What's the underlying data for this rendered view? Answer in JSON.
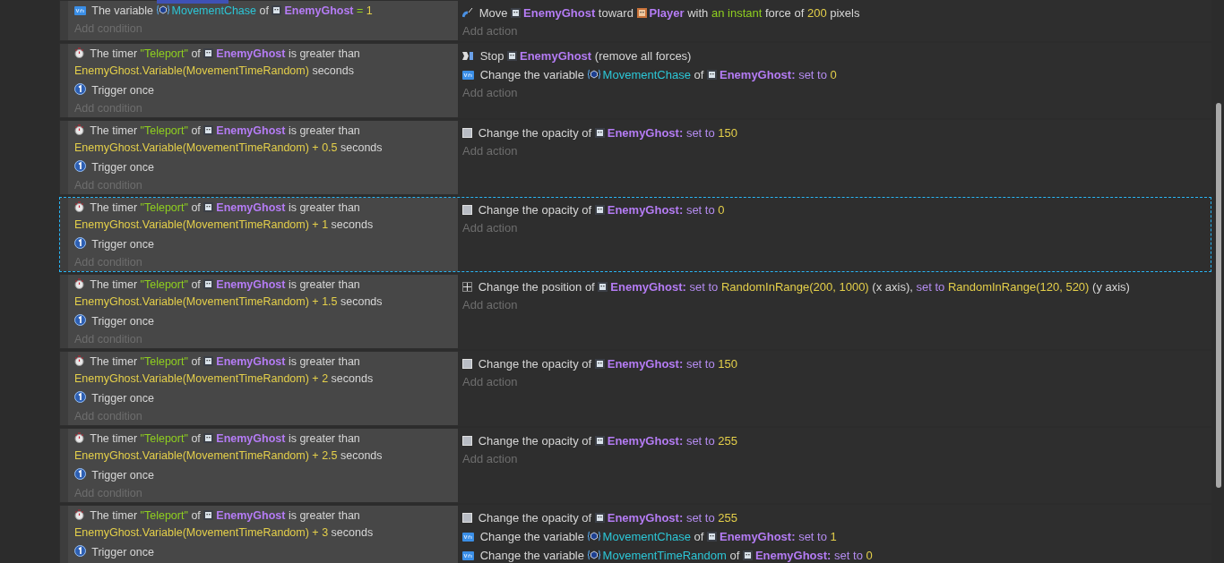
{
  "events": [
    {
      "selected": false,
      "conditions": [
        {
          "kind": "variable",
          "parts": [
            {
              "kind": "text",
              "text": "The variable"
            },
            {
              "kind": "variable",
              "text": "MovementChase"
            },
            {
              "kind": "text",
              "text": "of"
            },
            {
              "kind": "object",
              "text": "EnemyGhost"
            },
            {
              "kind": "choice",
              "text": "="
            },
            {
              "kind": "expr",
              "text": "1"
            }
          ]
        }
      ],
      "add_condition": "Add condition",
      "actions": [
        {
          "kind": "force",
          "parts": [
            {
              "kind": "text",
              "text": "Move"
            },
            {
              "kind": "object",
              "text": "EnemyGhost"
            },
            {
              "kind": "text",
              "text": "toward"
            },
            {
              "kind": "player",
              "text": "Player"
            },
            {
              "kind": "text",
              "text": "with"
            },
            {
              "kind": "choice",
              "text": "an instant"
            },
            {
              "kind": "text",
              "text": "force of"
            },
            {
              "kind": "expr",
              "text": "200"
            },
            {
              "kind": "text",
              "text": "pixels"
            }
          ]
        }
      ],
      "add_action": "Add action"
    },
    {
      "selected": false,
      "conditions": [
        {
          "kind": "timer",
          "parts": [
            {
              "kind": "text",
              "text": "The timer"
            },
            {
              "kind": "string",
              "text": "\"Teleport\""
            },
            {
              "kind": "text",
              "text": "of"
            },
            {
              "kind": "object",
              "text": "EnemyGhost"
            },
            {
              "kind": "text",
              "text": "is greater than"
            },
            {
              "kind": "expr",
              "text": "EnemyGhost.Variable(MovementTimeRandom)"
            },
            {
              "kind": "text",
              "text": "seconds"
            }
          ]
        },
        {
          "kind": "trigger",
          "parts": [
            {
              "kind": "text",
              "text": "Trigger once"
            }
          ]
        }
      ],
      "add_condition": "Add condition",
      "actions": [
        {
          "kind": "stop",
          "parts": [
            {
              "kind": "text",
              "text": "Stop"
            },
            {
              "kind": "object",
              "text": "EnemyGhost"
            },
            {
              "kind": "text",
              "text": "(remove all forces)"
            }
          ]
        },
        {
          "kind": "variable",
          "parts": [
            {
              "kind": "text",
              "text": "Change the variable"
            },
            {
              "kind": "variable",
              "text": "MovementChase"
            },
            {
              "kind": "text",
              "text": "of"
            },
            {
              "kind": "object",
              "text": "EnemyGhost:"
            },
            {
              "kind": "keyword",
              "text": "set to"
            },
            {
              "kind": "expr",
              "text": "0"
            }
          ]
        }
      ],
      "add_action": "Add action"
    },
    {
      "selected": false,
      "conditions": [
        {
          "kind": "timer",
          "parts": [
            {
              "kind": "text",
              "text": "The timer"
            },
            {
              "kind": "string",
              "text": "\"Teleport\""
            },
            {
              "kind": "text",
              "text": "of"
            },
            {
              "kind": "object",
              "text": "EnemyGhost"
            },
            {
              "kind": "text",
              "text": "is greater than"
            },
            {
              "kind": "expr",
              "text": "EnemyGhost.Variable(MovementTimeRandom) + 0.5"
            },
            {
              "kind": "text",
              "text": "seconds"
            }
          ]
        },
        {
          "kind": "trigger",
          "parts": [
            {
              "kind": "text",
              "text": "Trigger once"
            }
          ]
        }
      ],
      "add_condition": "Add condition",
      "actions": [
        {
          "kind": "opacity",
          "parts": [
            {
              "kind": "text",
              "text": "Change the opacity of"
            },
            {
              "kind": "object",
              "text": "EnemyGhost:"
            },
            {
              "kind": "keyword",
              "text": "set to"
            },
            {
              "kind": "expr",
              "text": "150"
            }
          ]
        }
      ],
      "add_action": "Add action"
    },
    {
      "selected": true,
      "conditions": [
        {
          "kind": "timer",
          "parts": [
            {
              "kind": "text",
              "text": "The timer"
            },
            {
              "kind": "string",
              "text": "\"Teleport\""
            },
            {
              "kind": "text",
              "text": "of"
            },
            {
              "kind": "object",
              "text": "EnemyGhost"
            },
            {
              "kind": "text",
              "text": "is greater than"
            },
            {
              "kind": "expr",
              "text": "EnemyGhost.Variable(MovementTimeRandom) + 1"
            },
            {
              "kind": "text",
              "text": "seconds"
            }
          ]
        },
        {
          "kind": "trigger",
          "parts": [
            {
              "kind": "text",
              "text": "Trigger once"
            }
          ]
        }
      ],
      "add_condition": "Add condition",
      "actions": [
        {
          "kind": "opacity",
          "parts": [
            {
              "kind": "text",
              "text": "Change the opacity of"
            },
            {
              "kind": "object",
              "text": "EnemyGhost:"
            },
            {
              "kind": "keyword",
              "text": "set to"
            },
            {
              "kind": "expr",
              "text": "0"
            }
          ]
        }
      ],
      "add_action": "Add action"
    },
    {
      "selected": false,
      "conditions": [
        {
          "kind": "timer",
          "parts": [
            {
              "kind": "text",
              "text": "The timer"
            },
            {
              "kind": "string",
              "text": "\"Teleport\""
            },
            {
              "kind": "text",
              "text": "of"
            },
            {
              "kind": "object",
              "text": "EnemyGhost"
            },
            {
              "kind": "text",
              "text": "is greater than"
            },
            {
              "kind": "expr",
              "text": "EnemyGhost.Variable(MovementTimeRandom) + 1.5"
            },
            {
              "kind": "text",
              "text": "seconds"
            }
          ]
        },
        {
          "kind": "trigger",
          "parts": [
            {
              "kind": "text",
              "text": "Trigger once"
            }
          ]
        }
      ],
      "add_condition": "Add condition",
      "actions": [
        {
          "kind": "position",
          "parts": [
            {
              "kind": "text",
              "text": "Change the position of"
            },
            {
              "kind": "object",
              "text": "EnemyGhost:"
            },
            {
              "kind": "keyword",
              "text": "set to"
            },
            {
              "kind": "expr",
              "text": "RandomInRange(200, 1000)"
            },
            {
              "kind": "text",
              "text": "(x axis),"
            },
            {
              "kind": "keyword",
              "text": "set to"
            },
            {
              "kind": "expr",
              "text": "RandomInRange(120, 520)"
            },
            {
              "kind": "text",
              "text": "(y axis)"
            }
          ]
        }
      ],
      "add_action": "Add action"
    },
    {
      "selected": false,
      "conditions": [
        {
          "kind": "timer",
          "parts": [
            {
              "kind": "text",
              "text": "The timer"
            },
            {
              "kind": "string",
              "text": "\"Teleport\""
            },
            {
              "kind": "text",
              "text": "of"
            },
            {
              "kind": "object",
              "text": "EnemyGhost"
            },
            {
              "kind": "text",
              "text": "is greater than"
            },
            {
              "kind": "expr",
              "text": "EnemyGhost.Variable(MovementTimeRandom) + 2"
            },
            {
              "kind": "text",
              "text": "seconds"
            }
          ]
        },
        {
          "kind": "trigger",
          "parts": [
            {
              "kind": "text",
              "text": "Trigger once"
            }
          ]
        }
      ],
      "add_condition": "Add condition",
      "actions": [
        {
          "kind": "opacity",
          "parts": [
            {
              "kind": "text",
              "text": "Change the opacity of"
            },
            {
              "kind": "object",
              "text": "EnemyGhost:"
            },
            {
              "kind": "keyword",
              "text": "set to"
            },
            {
              "kind": "expr",
              "text": "150"
            }
          ]
        }
      ],
      "add_action": "Add action"
    },
    {
      "selected": false,
      "conditions": [
        {
          "kind": "timer",
          "parts": [
            {
              "kind": "text",
              "text": "The timer"
            },
            {
              "kind": "string",
              "text": "\"Teleport\""
            },
            {
              "kind": "text",
              "text": "of"
            },
            {
              "kind": "object",
              "text": "EnemyGhost"
            },
            {
              "kind": "text",
              "text": "is greater than"
            },
            {
              "kind": "expr",
              "text": "EnemyGhost.Variable(MovementTimeRandom) + 2.5"
            },
            {
              "kind": "text",
              "text": "seconds"
            }
          ]
        },
        {
          "kind": "trigger",
          "parts": [
            {
              "kind": "text",
              "text": "Trigger once"
            }
          ]
        }
      ],
      "add_condition": "Add condition",
      "actions": [
        {
          "kind": "opacity",
          "parts": [
            {
              "kind": "text",
              "text": "Change the opacity of"
            },
            {
              "kind": "object",
              "text": "EnemyGhost:"
            },
            {
              "kind": "keyword",
              "text": "set to"
            },
            {
              "kind": "expr",
              "text": "255"
            }
          ]
        }
      ],
      "add_action": "Add action"
    },
    {
      "selected": false,
      "conditions": [
        {
          "kind": "timer",
          "parts": [
            {
              "kind": "text",
              "text": "The timer"
            },
            {
              "kind": "string",
              "text": "\"Teleport\""
            },
            {
              "kind": "text",
              "text": "of"
            },
            {
              "kind": "object",
              "text": "EnemyGhost"
            },
            {
              "kind": "text",
              "text": "is greater than"
            },
            {
              "kind": "expr",
              "text": "EnemyGhost.Variable(MovementTimeRandom) + 3"
            },
            {
              "kind": "text",
              "text": "seconds"
            }
          ]
        },
        {
          "kind": "trigger",
          "parts": [
            {
              "kind": "text",
              "text": "Trigger once"
            }
          ]
        }
      ],
      "actions": [
        {
          "kind": "opacity",
          "parts": [
            {
              "kind": "text",
              "text": "Change the opacity of"
            },
            {
              "kind": "object",
              "text": "EnemyGhost:"
            },
            {
              "kind": "keyword",
              "text": "set to"
            },
            {
              "kind": "expr",
              "text": "255"
            }
          ]
        },
        {
          "kind": "variable",
          "parts": [
            {
              "kind": "text",
              "text": "Change the variable"
            },
            {
              "kind": "variable",
              "text": "MovementChase"
            },
            {
              "kind": "text",
              "text": "of"
            },
            {
              "kind": "object",
              "text": "EnemyGhost:"
            },
            {
              "kind": "keyword",
              "text": "set to"
            },
            {
              "kind": "expr",
              "text": "1"
            }
          ]
        },
        {
          "kind": "variable",
          "parts": [
            {
              "kind": "text",
              "text": "Change the variable"
            },
            {
              "kind": "variable",
              "text": "MovementTimeRandom"
            },
            {
              "kind": "text",
              "text": "of"
            },
            {
              "kind": "object",
              "text": "EnemyGhost:"
            },
            {
              "kind": "keyword",
              "text": "set to"
            },
            {
              "kind": "expr",
              "text": "0"
            }
          ]
        }
      ]
    }
  ]
}
